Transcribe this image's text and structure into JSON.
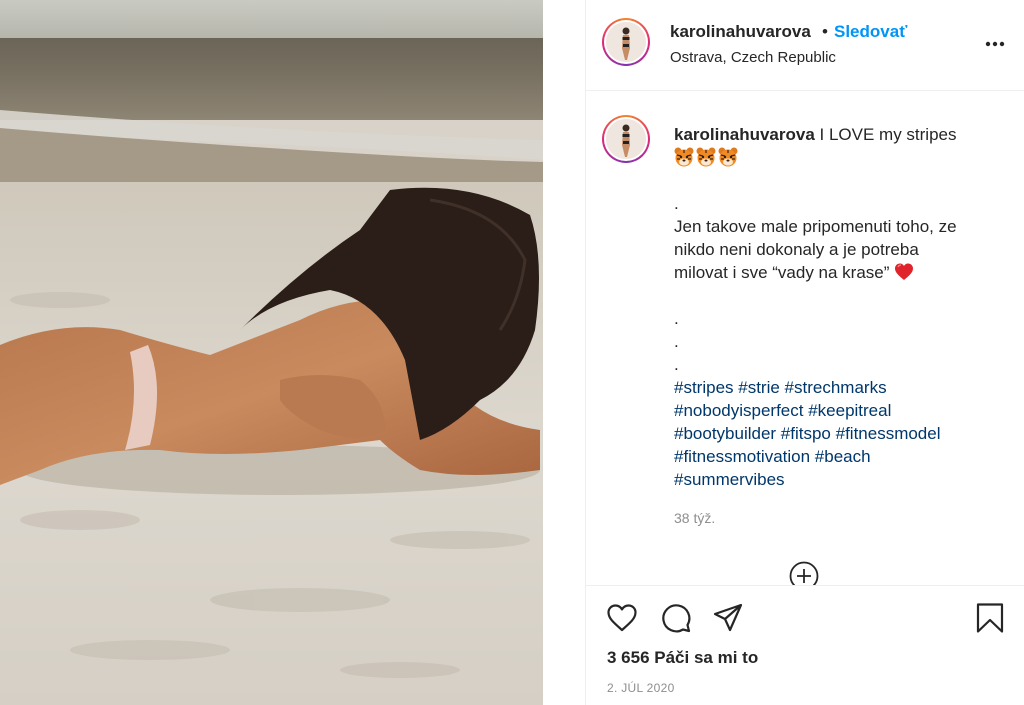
{
  "header": {
    "username": "karolinahuvarova",
    "separator": "•",
    "follow_label": "Sledovať",
    "location": "Ostrava, Czech Republic",
    "more_icon": "more-horizontal-icon"
  },
  "caption": {
    "username": "karolinahuvarova",
    "lines": [
      "I LOVE my stripes",
      "",
      ".",
      "Jen takove male pripomenuti toho, ze",
      "nikdo neni dokonaly a je potreba",
      "milovat i sve “vady na krase”",
      "",
      ".",
      ".",
      "."
    ],
    "emoji_icons": [
      "tiger-face-icon",
      "tiger-face-icon",
      "tiger-face-icon",
      "red-heart-icon"
    ],
    "hashtags": [
      "#stripes #strie #strechmarks",
      "#nobodyisperfect #keepitreal",
      "#bootybuilder #fitspo #fitnessmodel",
      "#fitnessmotivation #beach",
      "#summervibes"
    ],
    "time_ago": "38 týž.",
    "load_more_icon": "plus-circle-icon"
  },
  "actions": {
    "icons": [
      "heart-icon",
      "comment-icon",
      "share-icon",
      "bookmark-icon"
    ],
    "likes": "3 656 Páči sa mi to",
    "date": "2. JÚL 2020"
  },
  "colors": {
    "link_blue": "#0095f6",
    "hashtag_blue": "#00376b",
    "text": "#262626",
    "muted": "#8e8e8e",
    "divider": "#efefef",
    "story_ring_start": "#f58529",
    "story_ring_end": "#8134af"
  }
}
